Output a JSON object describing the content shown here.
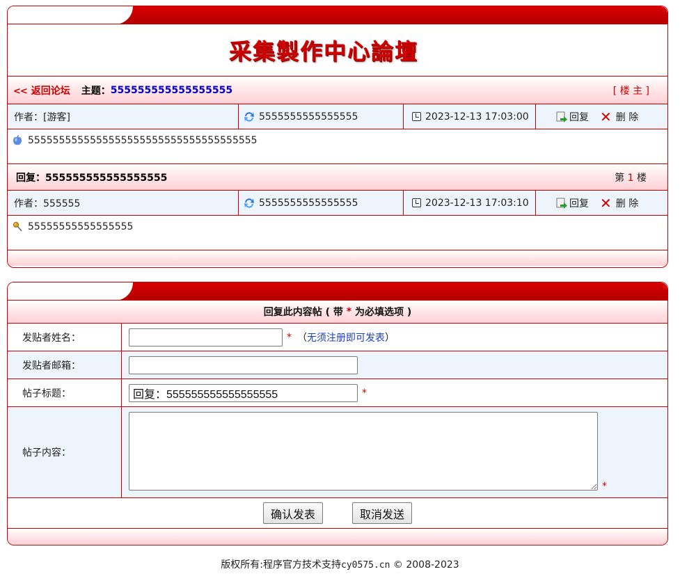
{
  "header": {
    "logo_text": "采集製作中心論壇"
  },
  "topic": {
    "back_arrows": "<<",
    "back_label": "返回论坛",
    "subject_label": "主题：",
    "subject": "555555555555555555",
    "floor_tag": "[ 楼 主 ]"
  },
  "posts": [
    {
      "author_label": "作者：[游客]",
      "user": "5555555555555555",
      "time": "2023-12-13 17:03:00",
      "reply_label": "回复",
      "delete_label": "删 除",
      "content": "5555555555555555555555555555555555555"
    },
    {
      "author_label": "作者：555555",
      "user": "5555555555555555",
      "time": "2023-12-13 17:03:10",
      "reply_label": "回复",
      "delete_label": "删 除",
      "content": "55555555555555555"
    }
  ],
  "reply_header": {
    "label": "回复：555555555555555555",
    "floor_prefix": "第",
    "floor_num": "1",
    "floor_suffix": "楼"
  },
  "form": {
    "title_prefix": "回复此内容帖 ( 带",
    "title_star": "*",
    "title_suffix": "为必填选项 )",
    "name_label": "发贴者姓名：",
    "name_value": "",
    "name_hint_open": "（",
    "name_hint": "无须注册即可发表",
    "name_hint_close": "）",
    "email_label": "发贴者邮箱：",
    "email_value": "",
    "title_label": "帖子标题：",
    "title_value": "回复：555555555555555555",
    "content_label": "帖子内容：",
    "content_value": "",
    "required_mark": "*",
    "submit_label": "确认发表",
    "cancel_label": "取消发送"
  },
  "footer": {
    "text_prefix": "版权所有:程序官方技术支持",
    "domain": "cy0575.cn",
    "text_suffix": "© 2008-2023"
  },
  "colors": {
    "accent": "#cc0000",
    "link": "#0000cc",
    "row_bg": "#eef4fb"
  }
}
